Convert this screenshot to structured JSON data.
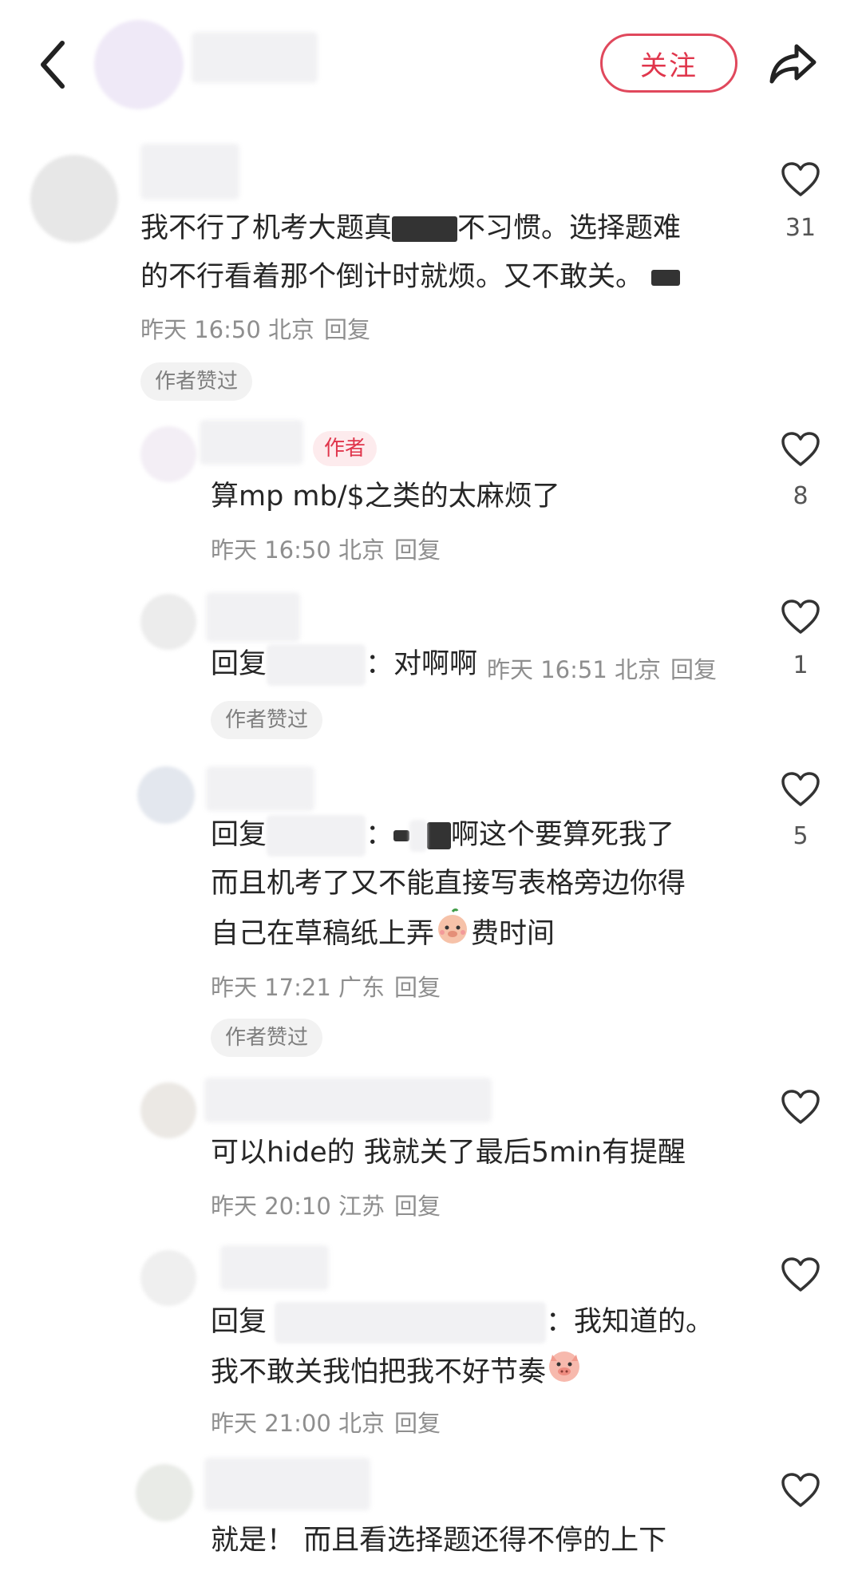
{
  "header": {
    "back_icon": "chevron-left-icon",
    "follow_label": "关注",
    "share_icon": "share-icon",
    "accent": "#e0364c"
  },
  "comments": [
    {
      "text_lines": [
        "我不行了机考大题真",
        "不习惯。选择题难",
        "的不行看着那个倒计时就烦。又不敢关。"
      ],
      "meta": "昨天 16:50 北京",
      "reply": "回复",
      "badge": "作者赞过",
      "likes": "31"
    },
    {
      "author_tag": "作者",
      "text": "算mp mb/$之类的太麻烦了",
      "meta": "昨天 16:50 北京",
      "reply": "回复",
      "likes": "8"
    },
    {
      "reply_prefix": "回复",
      "text": "：对啊啊",
      "meta": "昨天 16:51 北京",
      "reply": "回复",
      "badge": "作者赞过",
      "likes": "1"
    },
    {
      "reply_prefix": "回复",
      "text_lines": [
        "啊这个要算死我了",
        "而且机考了又不能直接写表格旁边你得",
        "自己在草稿纸上弄",
        "费时间"
      ],
      "meta": "昨天 17:21 广东",
      "reply": "回复",
      "badge": "作者赞过",
      "likes": "5"
    },
    {
      "text": "可以hide的 我就关了最后5min有提醒",
      "meta": "昨天 20:10 江苏",
      "reply": "回复",
      "likes": ""
    },
    {
      "reply_prefix": "回复",
      "text_lines": [
        "：我知道的。",
        "我不敢关我怕把我不好节奏"
      ],
      "meta": "昨天 21:00 北京",
      "reply": "回复",
      "likes": ""
    },
    {
      "text": "就是！ 而且看选择题还得不停的上下",
      "likes": ""
    }
  ]
}
